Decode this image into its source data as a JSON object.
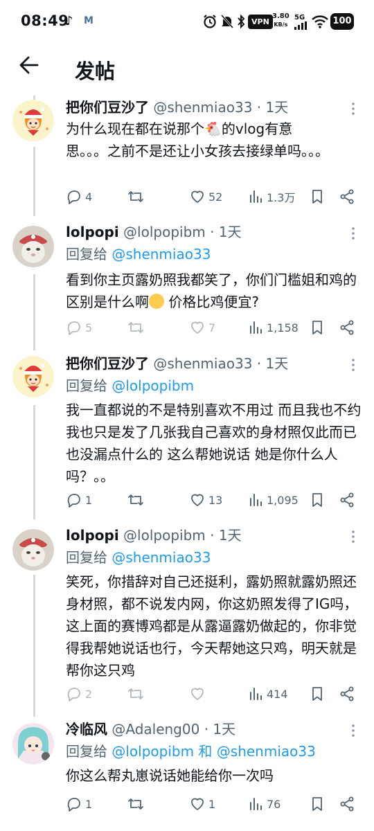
{
  "status_bar": {
    "time": "08:49",
    "vpn": "VPN",
    "speed_value": "3.80",
    "speed_unit": "KB/s",
    "network": "5G",
    "battery": "100"
  },
  "header": {
    "title": "发帖"
  },
  "colors": {
    "accent": "#1d9bf0",
    "text": "#0f1419",
    "muted": "#536471",
    "line": "#cfd9de"
  },
  "posts": [
    {
      "name": "把你们豆沙了",
      "handle": "@shenmiao33",
      "dot": "·",
      "time": "1天",
      "reply_to_label": "",
      "reply_to_users": "",
      "text": "为什么现在都在说那个🐔的vlog有意思。。。之前不是还让小女孩去接绿单吗。。。",
      "stats": {
        "replies": "4",
        "retweets": "",
        "likes": "52",
        "views": "1.3万"
      }
    },
    {
      "name": "lolpopi",
      "handle": "@lolpopibm",
      "dot": "·",
      "time": "1天",
      "reply_to_label": "回复给",
      "reply_to_users": "@shenmiao33",
      "text_part1": "看到你主页露奶照我都笑了，你们门槛姐和鸡的区别是什么啊",
      "text_part2": " 价格比鸡便宜?",
      "stats": {
        "replies": "5",
        "retweets": "",
        "likes": "7",
        "views": "1,158"
      }
    },
    {
      "name": "把你们豆沙了",
      "handle": "@shenmiao33",
      "dot": "·",
      "time": "1天",
      "reply_to_label": "回复给",
      "reply_to_users": "@lolpopibm",
      "text": "我一直都说的不是特别喜欢不用过 而且我也不约 我也只是发了几张我自己喜欢的身材照仅此而已 也没漏点什么的 这么帮她说话 她是你什么人吗？。。",
      "stats": {
        "replies": "1",
        "retweets": "",
        "likes": "13",
        "views": "1,095"
      }
    },
    {
      "name": "lolpopi",
      "handle": "@lolpopibm",
      "dot": "·",
      "time": "1天",
      "reply_to_label": "回复给",
      "reply_to_users": "@shenmiao33",
      "text": "笑死，你措辞对自己还挺利，露奶照就露奶照还身材照，都不说发内网，你这奶照发得了IG吗，这上面的赛博鸡都是从露逼露奶做起的，你非觉得我帮她说话也行，今天帮她这只鸡，明天就是帮你这只鸡",
      "stats": {
        "replies": "2",
        "retweets": "",
        "likes": "",
        "views": "414"
      }
    },
    {
      "name": "冷临风",
      "handle": "@Adaleng00",
      "dot": "·",
      "time": "1天",
      "reply_to_label": "回复给",
      "reply_to_users": "@lolpopibm 和 @shenmiao33",
      "text": "你这么帮丸崽说话她能给你一次吗",
      "stats": {
        "replies": "1",
        "retweets": "",
        "likes": "1",
        "views": "76"
      }
    }
  ]
}
